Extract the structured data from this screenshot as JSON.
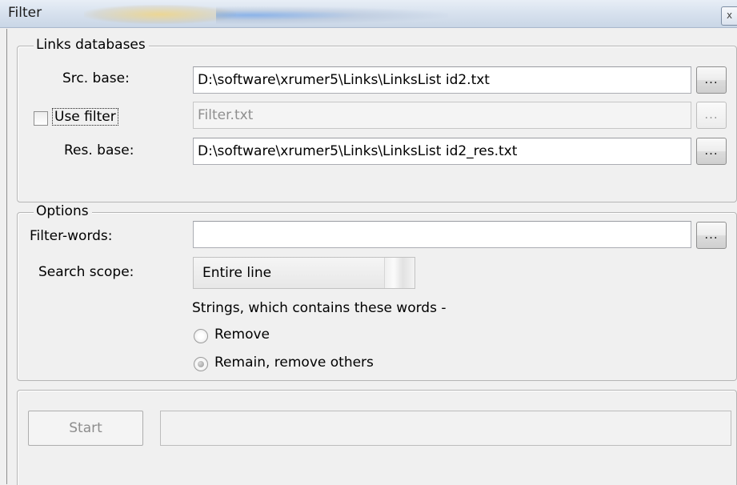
{
  "window": {
    "title": "Filter",
    "close_glyph": "x"
  },
  "links_databases": {
    "legend": "Links databases",
    "src_base_label": "Src. base:",
    "src_base_value": "D:\\software\\xrumer5\\Links\\LinksList id2.txt",
    "use_filter_label": "Use filter",
    "use_filter_checked": false,
    "filter_value": "Filter.txt",
    "res_base_label": "Res. base:",
    "res_base_value": "D:\\software\\xrumer5\\Links\\LinksList id2_res.txt",
    "browse_label": "..."
  },
  "options": {
    "legend": "Options",
    "filter_words_label": "Filter-words:",
    "filter_words_value": "",
    "search_scope_label": "Search scope:",
    "search_scope_value": "Entire line",
    "strings_caption": "Strings, which contains these words -",
    "radio_remove_label": "Remove",
    "radio_remain_label": "Remain, remove others",
    "selected_radio": "Remain, remove others",
    "browse_label": "..."
  },
  "actions": {
    "start_label": "Start",
    "status_text": ""
  }
}
